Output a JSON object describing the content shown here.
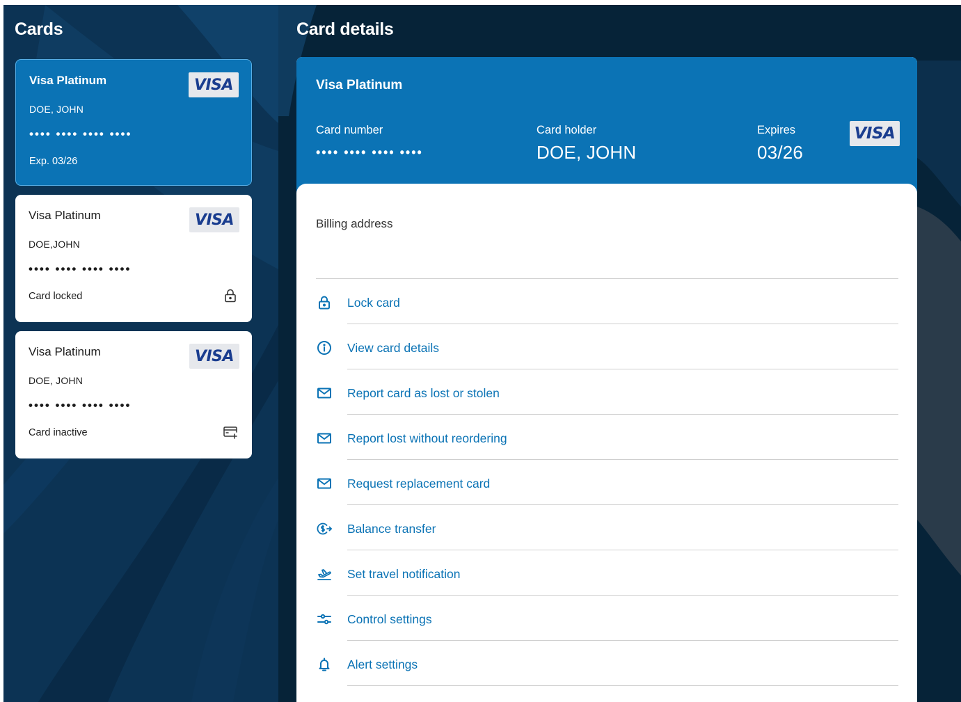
{
  "colors": {
    "accent": "#0b73b5",
    "background_dark": "#0b2a45",
    "card_white": "#ffffff",
    "visa_badge_bg": "#e6e8ec",
    "visa_badge_text": "#1a3d8f",
    "divider": "#cfcfcf"
  },
  "cards_panel": {
    "title": "Cards",
    "cards": [
      {
        "name": "Visa Platinum",
        "holder": "DOE, JOHN",
        "number_masked": "•••• •••• •••• ••••",
        "status": "Exp. 03/26",
        "brand": "VISA",
        "status_icon": null,
        "selected": true
      },
      {
        "name": "Visa Platinum",
        "holder": "DOE,JOHN",
        "number_masked": "•••• •••• •••• ••••",
        "status": "Card locked",
        "brand": "VISA",
        "status_icon": "lock-icon",
        "selected": false
      },
      {
        "name": "Visa Platinum",
        "holder": "DOE, JOHN",
        "number_masked": "•••• •••• •••• ••••",
        "status": "Card inactive",
        "brand": "VISA",
        "status_icon": "card-activate-icon",
        "selected": false
      }
    ]
  },
  "details_panel": {
    "title": "Card details",
    "header": {
      "card_name": "Visa Platinum",
      "card_number_label": "Card number",
      "card_number": "•••• •••• •••• ••••",
      "card_holder_label": "Card holder",
      "card_holder": "DOE, JOHN",
      "expires_label": "Expires",
      "expires": "03/26",
      "brand": "VISA"
    },
    "billing_address_label": "Billing address",
    "actions": [
      {
        "label": "Lock card",
        "icon": "lock-icon"
      },
      {
        "label": "View card details",
        "icon": "info-icon"
      },
      {
        "label": "Report card as lost or stolen",
        "icon": "mail-icon"
      },
      {
        "label": "Report lost without reordering",
        "icon": "mail-icon"
      },
      {
        "label": "Request replacement card",
        "icon": "mail-icon"
      },
      {
        "label": "Balance transfer",
        "icon": "balance-transfer-icon"
      },
      {
        "label": "Set travel notification",
        "icon": "plane-icon"
      },
      {
        "label": "Control settings",
        "icon": "sliders-icon"
      },
      {
        "label": "Alert settings",
        "icon": "bell-icon"
      }
    ]
  }
}
